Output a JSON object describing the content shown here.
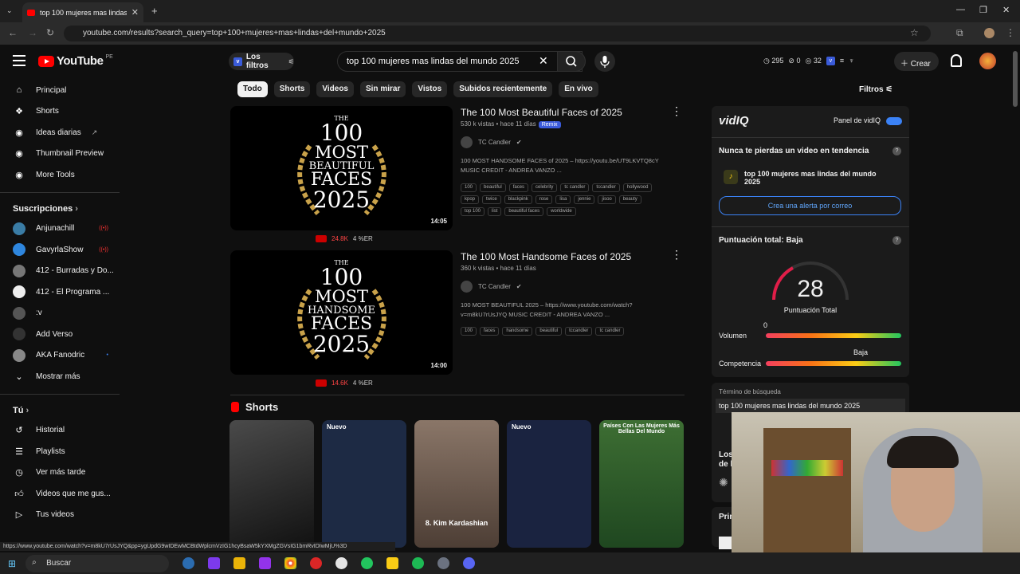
{
  "browser": {
    "tab_title": "top 100 mujeres mas lindas del",
    "url": "youtube.com/results?search_query=top+100+mujeres+mas+lindas+del+mundo+2025",
    "status_url": "https://www.youtube.com/watch?v=m8kU7rUsJYQ&pp=ygUpdG9wIDEwMCBtdWplcmVzIG1hcyBsaW5kYXMgZGVsIG1bmRvIDIwMjU%3D"
  },
  "header": {
    "logo": "YouTube",
    "region": "PE",
    "filters_label": "Los filtros",
    "search_value": "top 100 mujeres mas lindas del mundo 2025",
    "stats": [
      "295",
      "0",
      "32"
    ],
    "create_label": "Crear"
  },
  "sidebar": {
    "main": [
      {
        "label": "Principal",
        "icon": "home-icon"
      },
      {
        "label": "Shorts",
        "icon": "shorts-icon"
      },
      {
        "label": "Ideas diarias",
        "icon": "vidiq-icon"
      },
      {
        "label": "Thumbnail Preview",
        "icon": "vidiq-icon"
      },
      {
        "label": "More Tools",
        "icon": "vidiq-icon"
      }
    ],
    "subs_title": "Suscripciones",
    "subs": [
      {
        "label": "Anjunachill",
        "color": "#3a7ca5",
        "live": true
      },
      {
        "label": "GavyrlaShow",
        "color": "#2e86de",
        "live": true
      },
      {
        "label": "412 - Burradas y Do...",
        "color": "#777",
        "live": false
      },
      {
        "label": "412 - El Programa ...",
        "color": "#eee",
        "live": false
      },
      {
        "label": ":v",
        "color": "#555",
        "live": false
      },
      {
        "label": "Add Verso",
        "color": "#333",
        "live": false
      },
      {
        "label": "AKA Fanodric",
        "color": "#888",
        "live": false
      },
      {
        "label": "Mostrar más",
        "color": "",
        "live": false
      }
    ],
    "you_title": "Tú",
    "you": [
      {
        "label": "Historial"
      },
      {
        "label": "Playlists"
      },
      {
        "label": "Ver más tarde"
      },
      {
        "label": "Videos que me gus..."
      },
      {
        "label": "Tus videos"
      }
    ]
  },
  "chips": [
    "Todo",
    "Shorts",
    "Videos",
    "Sin mirar",
    "Vistos",
    "Subidos recientemente",
    "En vivo"
  ],
  "filters_right": "Filtros",
  "results": [
    {
      "title": "The 100 Most Beautiful Faces of 2025",
      "meta": "530 k vistas • hace 11 días",
      "badge": "Remix",
      "channel": "TC Candler",
      "desc": "100 MOST HANDSOME FACES of 2025 – https://youtu.be/UT9LKVTQ8cY MUSIC CREDIT - ANDREA VANZO ...",
      "tags": [
        "100",
        "beautiful",
        "faces",
        "celebrity",
        "tc candler",
        "tccandler",
        "hollywood",
        "kpop",
        "twice",
        "blackpink",
        "rose",
        "lisa",
        "jennie",
        "jisoo",
        "beauty",
        "top 100",
        "list",
        "beautiful faces",
        "worldwide"
      ],
      "duration": "14:05",
      "thumb_word": "BEAUTIFUL",
      "views_stat": "24.8K",
      "er": "4 %ER"
    },
    {
      "title": "The 100 Most Handsome Faces of 2025",
      "meta": "360 k vistas • hace 11 días",
      "badge": "",
      "channel": "TC Candler",
      "desc": "100 MOST BEAUTIFUL 2025 – https://www.youtube.com/watch?v=m8kU7rUsJYQ MUSIC CREDIT - ANDREA VANZO ...",
      "tags": [
        "100",
        "faces",
        "handsome",
        "beautiful",
        "tccandler",
        "tc candler"
      ],
      "duration": "14:00",
      "thumb_word": "HANDSOME",
      "views_stat": "14.6K",
      "er": "4 %ER"
    }
  ],
  "thumb_common": {
    "line1": "THE",
    "line2": "100",
    "line3": "MOST",
    "line5": "FACES",
    "line6": "2025"
  },
  "shorts_title": "Shorts",
  "shorts": [
    {
      "caption": "",
      "bg": "#3a3a3a"
    },
    {
      "caption": "Nuevo",
      "bg": "#1d2a44"
    },
    {
      "caption": "8. Kim Kardashian",
      "bg": "#6b5a4e"
    },
    {
      "caption": "Nuevo",
      "bg": "#1a2340"
    },
    {
      "caption": "Países Con Las Mujeres Más Bellas Del Mundo",
      "bg": "#2f5e2a"
    }
  ],
  "vidiq": {
    "brand": "vidIQ",
    "panel_label": "Panel de vidIQ",
    "trend_title": "Nunca te pierdas un video en tendencia",
    "trend_query": "top 100 mujeres mas lindas del mundo 2025",
    "alert_button": "Crea una alerta por correo",
    "score_title": "Puntuación total: Baja",
    "score": "28",
    "score_label": "Puntuación Total",
    "volume_label": "Volumen",
    "volume_value": "0",
    "competition_label": "Competencia",
    "competition_value": "Baja",
    "term_label": "Término de búsqueda",
    "term_value": "top 100 mujeres mas lindas del mundo 2025",
    "cut1": "Los",
    "cut2": "de l",
    "cut3": "Prin"
  },
  "taskbar": {
    "search": "Buscar"
  }
}
